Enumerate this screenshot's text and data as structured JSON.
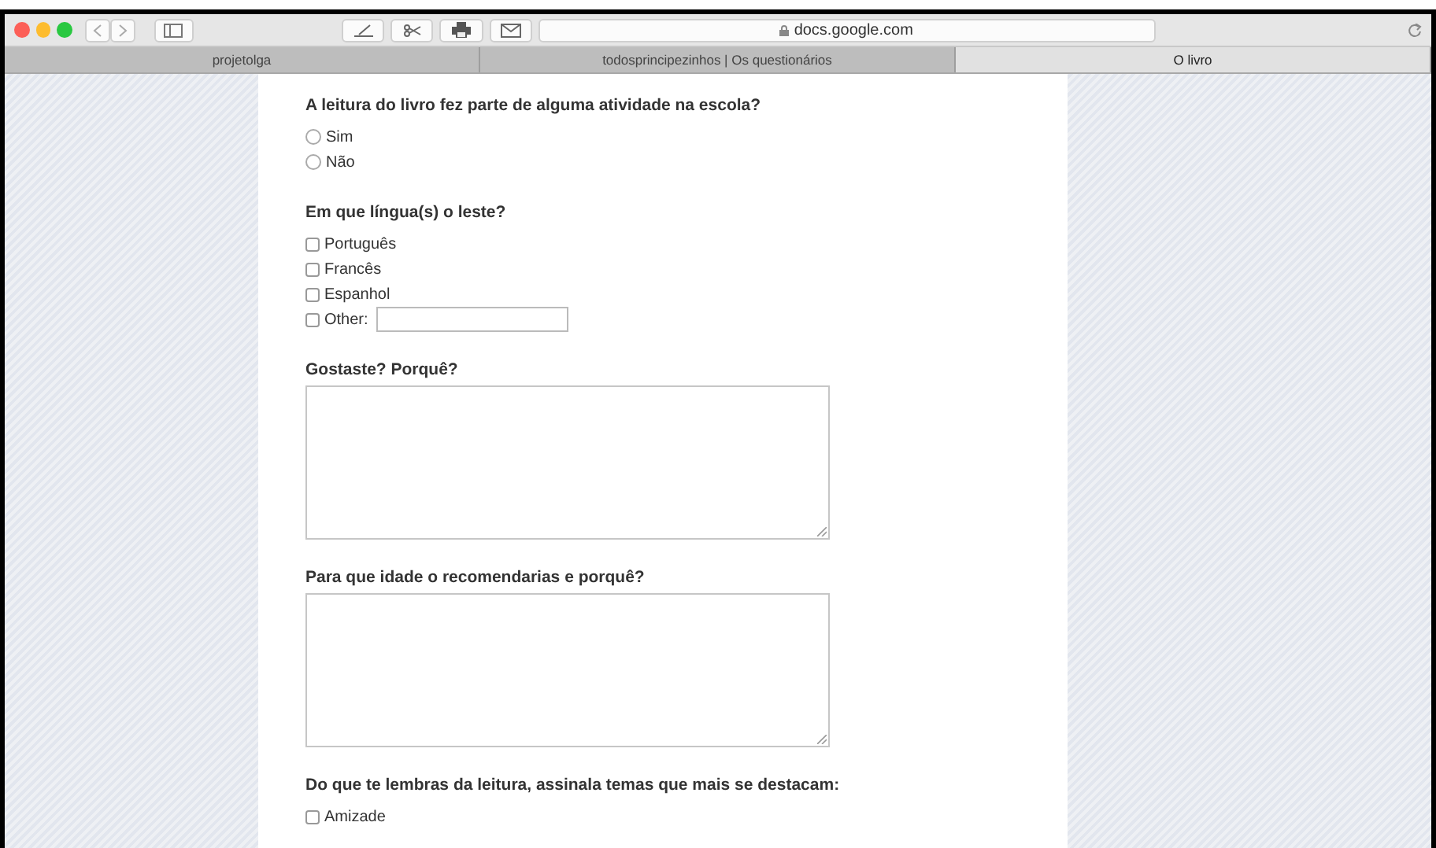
{
  "toolbar": {
    "address": "docs.google.com"
  },
  "tabs": [
    {
      "label": "projetolga",
      "selected": false
    },
    {
      "label": "todosprincipezinhos | Os questionários",
      "selected": false
    },
    {
      "label": "O livro",
      "selected": true
    }
  ],
  "questions": [
    {
      "kind": "radio",
      "title": "A leitura do livro fez parte de alguma atividade na escola?",
      "options": [
        {
          "label": "Sim",
          "selected": false
        },
        {
          "label": "Não",
          "selected": false
        }
      ]
    },
    {
      "kind": "checkbox",
      "title": "Em que língua(s) o leste?",
      "options": [
        {
          "label": "Português",
          "checked": false
        },
        {
          "label": "Francês",
          "checked": false
        },
        {
          "label": "Espanhol",
          "checked": false
        }
      ],
      "other": {
        "label": "Other:",
        "checked": false
      }
    },
    {
      "kind": "paragraph",
      "title": "Gostaste? Porquê?"
    },
    {
      "kind": "paragraph",
      "title": "Para que idade o recomendarias e porquê?"
    },
    {
      "kind": "checkbox",
      "title": "Do que te lembras da leitura, assinala temas que mais se destacam:",
      "options": [
        {
          "label": "Amizade",
          "checked": false
        }
      ]
    }
  ]
}
